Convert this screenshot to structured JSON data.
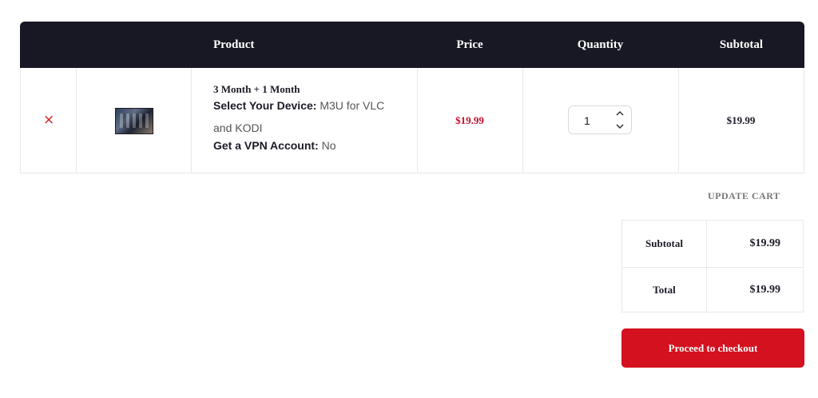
{
  "table_headers": {
    "product": "Product",
    "price": "Price",
    "quantity": "Quantity",
    "subtotal": "Subtotal"
  },
  "cart_item": {
    "remove_icon": "×",
    "thumbnail": "product-thumbnail",
    "title": "3 Month + 1 Month",
    "device_label": "Select Your Device:",
    "device_value_line1": "M3U for VLC",
    "device_value_line2": "and KODI",
    "vpn_label": "Get a VPN Account:",
    "vpn_value": "No",
    "price": "$19.99",
    "quantity": "1",
    "subtotal": "$19.99"
  },
  "update_cart_label": "UPDATE CART",
  "totals": {
    "subtotal_label": "Subtotal",
    "subtotal_value": "$19.99",
    "total_label": "Total",
    "total_value": "$19.99"
  },
  "checkout_label": "Proceed to checkout",
  "colors": {
    "header_bg": "#181824",
    "accent_red": "#d4111e",
    "price_red": "#c8102e"
  }
}
